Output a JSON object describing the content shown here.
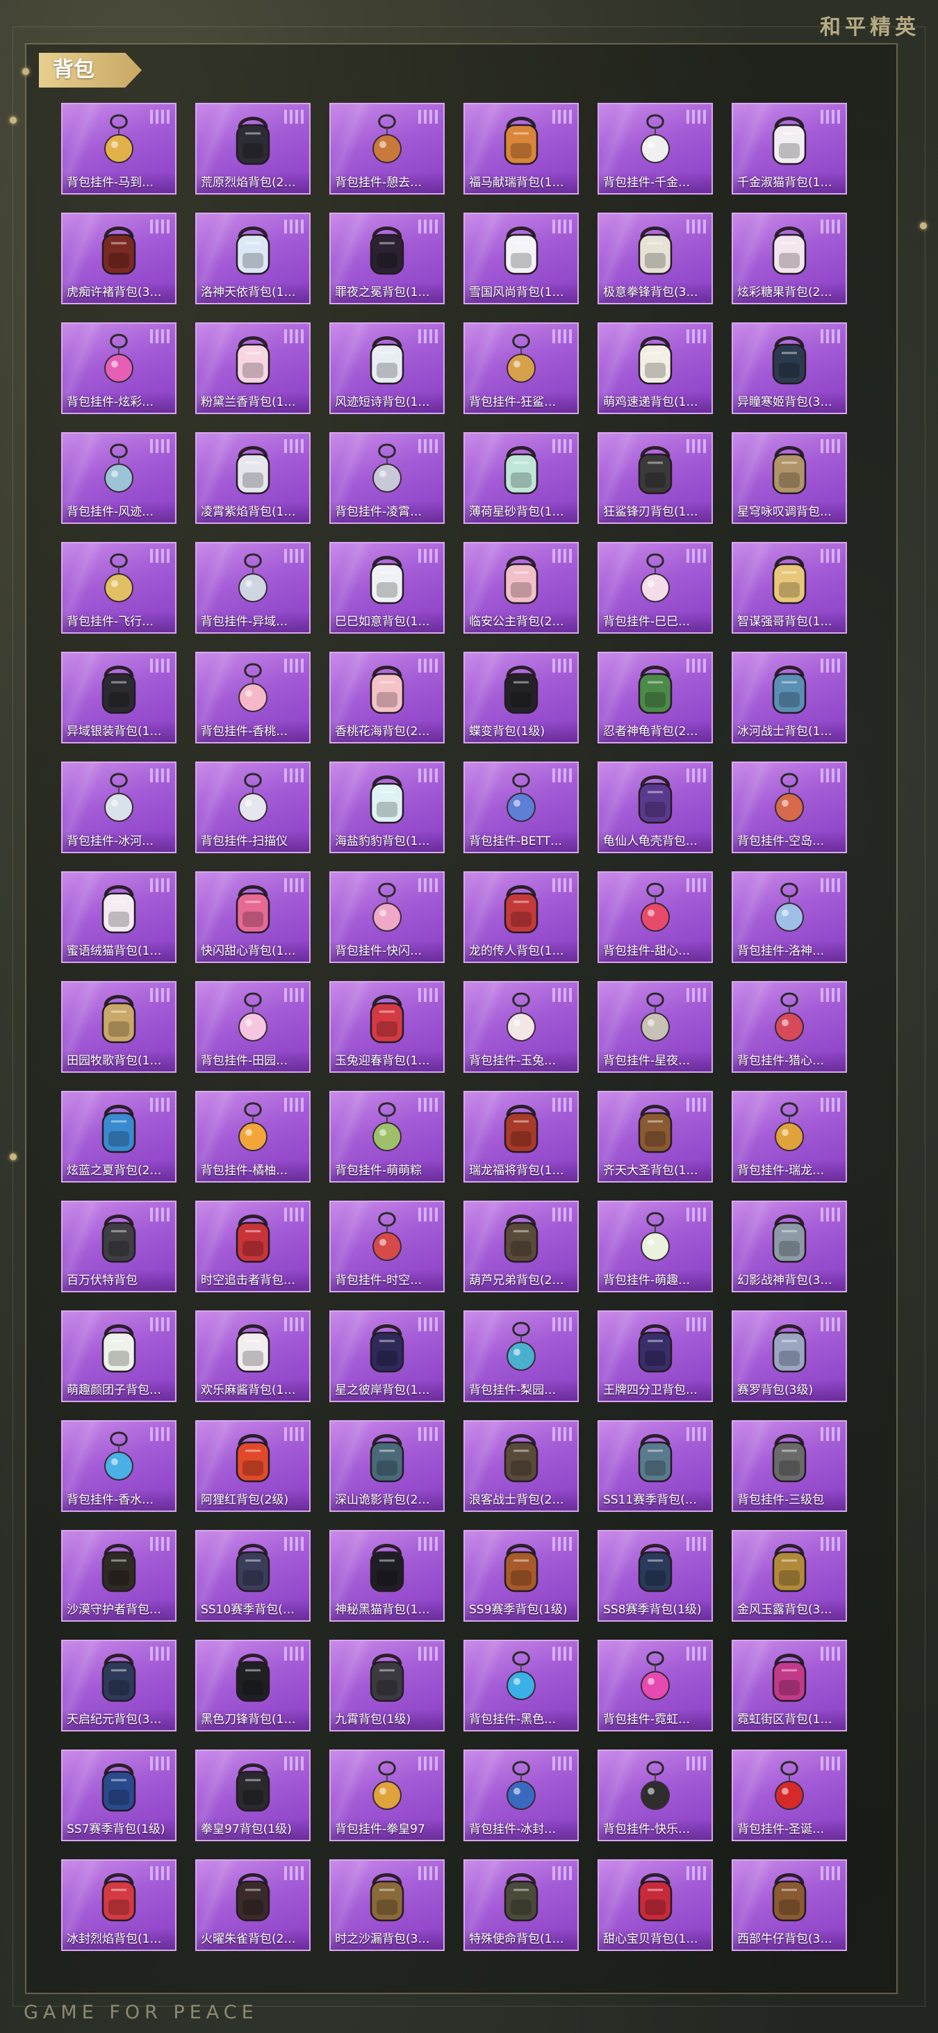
{
  "brand": {
    "logo_text": "和平精英",
    "footer_text": "GAME FOR PEACE"
  },
  "section": {
    "title": "背包"
  },
  "items": [
    {
      "name": "背包挂件-马到…",
      "icon": "horse-charm-icon",
      "color": "#e2b24a"
    },
    {
      "name": "荒原烈焰背包(2…",
      "icon": "backpack-icon",
      "color": "#2c2c34"
    },
    {
      "name": "背包挂件-憩去…",
      "icon": "tag-charm-icon",
      "color": "#c97a3a"
    },
    {
      "name": "福马献瑞背包(1…",
      "icon": "backpack-icon",
      "color": "#d9853a"
    },
    {
      "name": "背包挂件-千金…",
      "icon": "charm-icon",
      "color": "#f0f0f0"
    },
    {
      "name": "千金淑猫背包(1…",
      "icon": "backpack-icon",
      "color": "#f2eef2"
    },
    {
      "name": "虎痴许褚背包(3…",
      "icon": "backpack-icon",
      "color": "#7a2a22"
    },
    {
      "name": "洛神天依背包(1…",
      "icon": "backpack-icon",
      "color": "#dce8f5"
    },
    {
      "name": "罪夜之冕背包(1…",
      "icon": "backpack-icon",
      "color": "#2a2230"
    },
    {
      "name": "雪国风尚背包(1…",
      "icon": "backpack-icon",
      "color": "#f4f4f8"
    },
    {
      "name": "极意拳锋背包(3…",
      "icon": "backpack-icon",
      "color": "#e6e2d6"
    },
    {
      "name": "炫彩糖果背包(2…",
      "icon": "backpack-icon",
      "color": "#f4e6ee"
    },
    {
      "name": "背包挂件-炫彩…",
      "icon": "candy-charm-icon",
      "color": "#e55fb5"
    },
    {
      "name": "粉黛兰香背包(1…",
      "icon": "backpack-icon",
      "color": "#f7d6e2"
    },
    {
      "name": "风迹短诗背包(1…",
      "icon": "backpack-icon",
      "color": "#e8eef2"
    },
    {
      "name": "背包挂件-狂鲨…",
      "icon": "feather-charm-icon",
      "color": "#d6a14a"
    },
    {
      "name": "萌鸡速递背包(1…",
      "icon": "backpack-icon",
      "color": "#f3efe4"
    },
    {
      "name": "异瞳寒姬背包(3…",
      "icon": "backpack-icon",
      "color": "#2c3a4e"
    },
    {
      "name": "背包挂件-风迹…",
      "icon": "card-charm-icon",
      "color": "#9cc4d6"
    },
    {
      "name": "凌霄紫焰背包(1…",
      "icon": "backpack-icon",
      "color": "#e6e6ee"
    },
    {
      "name": "背包挂件-凌霄…",
      "icon": "gem-charm-icon",
      "color": "#c8c8d8"
    },
    {
      "name": "薄荷星砂背包(1…",
      "icon": "backpack-icon",
      "color": "#bfe6d8"
    },
    {
      "name": "狂鲨锋刃背包(1…",
      "icon": "backpack-icon",
      "color": "#3a3a3a"
    },
    {
      "name": "星穹咏叹调背包…",
      "icon": "backpack-icon",
      "color": "#b0946a"
    },
    {
      "name": "背包挂件-飞行…",
      "icon": "plane-charm-icon",
      "color": "#e1bf63"
    },
    {
      "name": "背包挂件-异域…",
      "icon": "gem-charm-icon",
      "color": "#cfd6e2"
    },
    {
      "name": "巳巳如意背包(1…",
      "icon": "backpack-icon",
      "color": "#eef2f4"
    },
    {
      "name": "临安公主背包(2…",
      "icon": "backpack-icon",
      "color": "#f2c0c8"
    },
    {
      "name": "背包挂件-巳巳…",
      "icon": "charm-icon",
      "color": "#f4dce8"
    },
    {
      "name": "智谋强哥背包(1…",
      "icon": "backpack-icon",
      "color": "#e8c77a"
    },
    {
      "name": "异域银装背包(1…",
      "icon": "backpack-icon",
      "color": "#2a2a30"
    },
    {
      "name": "背包挂件-香桃…",
      "icon": "flower-charm-icon",
      "color": "#f6b8c8"
    },
    {
      "name": "香桃花海背包(2…",
      "icon": "backpack-icon",
      "color": "#f5c2c8"
    },
    {
      "name": "蝶变背包(1级)",
      "icon": "backpack-icon",
      "color": "#232327"
    },
    {
      "name": "忍者神龟背包(2…",
      "icon": "backpack-icon",
      "color": "#4c8a4a"
    },
    {
      "name": "冰河战士背包(1…",
      "icon": "backpack-icon",
      "color": "#5b8fb4"
    },
    {
      "name": "背包挂件-冰河…",
      "icon": "robot-charm-icon",
      "color": "#d9e2ea"
    },
    {
      "name": "背包挂件-扫描仪",
      "icon": "scanner-charm-icon",
      "color": "#e6e6ee"
    },
    {
      "name": "海盐豹豹背包(1…",
      "icon": "backpack-icon",
      "color": "#dff2f4"
    },
    {
      "name": "背包挂件-BETT…",
      "icon": "gem-charm-icon",
      "color": "#5e7fd6"
    },
    {
      "name": "龟仙人龟壳背包…",
      "icon": "backpack-icon",
      "color": "#5a3a8e"
    },
    {
      "name": "背包挂件-空岛…",
      "icon": "key-charm-icon",
      "color": "#d66a4a"
    },
    {
      "name": "蜜语绒猫背包(1…",
      "icon": "backpack-icon",
      "color": "#f4ecf2"
    },
    {
      "name": "快闪甜心背包(1…",
      "icon": "backpack-icon",
      "color": "#e66a94"
    },
    {
      "name": "背包挂件-快闪…",
      "icon": "donut-charm-icon",
      "color": "#f0a8c8"
    },
    {
      "name": "龙的传人背包(1…",
      "icon": "backpack-icon",
      "color": "#c43a3a"
    },
    {
      "name": "背包挂件-甜心…",
      "icon": "lollipop-charm-icon",
      "color": "#e84a6a"
    },
    {
      "name": "背包挂件-洛神…",
      "icon": "bow-charm-icon",
      "color": "#9ec0e6"
    },
    {
      "name": "田园牧歌背包(1…",
      "icon": "backpack-icon",
      "color": "#c9a86a"
    },
    {
      "name": "背包挂件-田园…",
      "icon": "tag-charm-icon",
      "color": "#f6c6e0"
    },
    {
      "name": "玉兔迎春背包(1…",
      "icon": "backpack-icon",
      "color": "#d43a42"
    },
    {
      "name": "背包挂件-玉兔…",
      "icon": "rabbit-charm-icon",
      "color": "#f4e6e6"
    },
    {
      "name": "背包挂件-星夜…",
      "icon": "star-charm-icon",
      "color": "#c8c2b6"
    },
    {
      "name": "背包挂件-猎心…",
      "icon": "key-charm-icon",
      "color": "#d64a5a"
    },
    {
      "name": "炫蓝之夏背包(2…",
      "icon": "backpack-icon",
      "color": "#3a8ad0"
    },
    {
      "name": "背包挂件-橘柚…",
      "icon": "heart-charm-icon",
      "color": "#f2a63a"
    },
    {
      "name": "背包挂件-萌萌粽",
      "icon": "zongzi-charm-icon",
      "color": "#9ec06a"
    },
    {
      "name": "瑞龙福将背包(1…",
      "icon": "backpack-icon",
      "color": "#a83a2a"
    },
    {
      "name": "齐天大圣背包(1…",
      "icon": "backpack-icon",
      "color": "#8a5a32"
    },
    {
      "name": "背包挂件-瑞龙…",
      "icon": "orb-charm-icon",
      "color": "#e0a23a"
    },
    {
      "name": "百万伏特背包",
      "icon": "backpack-icon",
      "color": "#3e3e44"
    },
    {
      "name": "时空追击者背包…",
      "icon": "backpack-icon",
      "color": "#c8343a"
    },
    {
      "name": "背包挂件-时空…",
      "icon": "wing-charm-icon",
      "color": "#d64a4a"
    },
    {
      "name": "葫芦兄弟背包(2…",
      "icon": "backpack-icon",
      "color": "#5a4a3a"
    },
    {
      "name": "背包挂件-萌趣…",
      "icon": "slime-charm-icon",
      "color": "#e8f2dc"
    },
    {
      "name": "幻影战神背包(3…",
      "icon": "backpack-icon",
      "color": "#8e9aa6"
    },
    {
      "name": "萌趣颜团子背包…",
      "icon": "backpack-icon",
      "color": "#eef2ea"
    },
    {
      "name": "欢乐麻酱背包(1…",
      "icon": "backpack-icon",
      "color": "#f2eef0"
    },
    {
      "name": "星之彼岸背包(1…",
      "icon": "backpack-icon",
      "color": "#2e2a5a"
    },
    {
      "name": "背包挂件-梨园…",
      "icon": "lantern-charm-icon",
      "color": "#4ab0d0"
    },
    {
      "name": "王牌四分卫背包…",
      "icon": "backpack-icon",
      "color": "#3a2e6a"
    },
    {
      "name": "赛罗背包(3级)",
      "icon": "backpack-icon",
      "color": "#9aa6c2"
    },
    {
      "name": "背包挂件-香水…",
      "icon": "cocktail-charm-icon",
      "color": "#4ab0e6"
    },
    {
      "name": "阿狸红背包(2级)",
      "icon": "backpack-icon",
      "color": "#e04a2a"
    },
    {
      "name": "深山诡影背包(2…",
      "icon": "backpack-icon",
      "color": "#4a6a7a"
    },
    {
      "name": "浪客战士背包(2…",
      "icon": "backpack-icon",
      "color": "#5a4a3a"
    },
    {
      "name": "SS11赛季背包(…",
      "icon": "backpack-icon",
      "color": "#5a7a8e"
    },
    {
      "name": "背包挂件-三级包",
      "icon": "backpack-icon",
      "color": "#6a6a6a"
    },
    {
      "name": "沙漠守护者背包…",
      "icon": "backpack-icon",
      "color": "#2e2a24"
    },
    {
      "name": "SS10赛季背包(…",
      "icon": "backpack-icon",
      "color": "#3a3e5a"
    },
    {
      "name": "神秘黑猫背包(1…",
      "icon": "backpack-icon",
      "color": "#1e1e24"
    },
    {
      "name": "SS9赛季背包(1级)",
      "icon": "backpack-icon",
      "color": "#a85a2a"
    },
    {
      "name": "SS8赛季背包(1级)",
      "icon": "backpack-icon",
      "color": "#2a3a5a"
    },
    {
      "name": "金风玉露背包(3…",
      "icon": "backpack-icon",
      "color": "#b08a3a"
    },
    {
      "name": "天启纪元背包(3…",
      "icon": "backpack-icon",
      "color": "#2e3a5a"
    },
    {
      "name": "黑色刀锋背包(1…",
      "icon": "backpack-icon",
      "color": "#1e2024"
    },
    {
      "name": "九霄背包(1级)",
      "icon": "backpack-icon",
      "color": "#3a3a40"
    },
    {
      "name": "背包挂件-黑色…",
      "icon": "badge-charm-icon",
      "color": "#3ab0e6"
    },
    {
      "name": "背包挂件-霓虹…",
      "icon": "hat-charm-icon",
      "color": "#e64ab0"
    },
    {
      "name": "霓虹街区背包(1…",
      "icon": "backpack-icon",
      "color": "#c23a8a"
    },
    {
      "name": "SS7赛季背包(1级)",
      "icon": "backpack-icon",
      "color": "#2a4a8e"
    },
    {
      "name": "拳皇97背包(1级)",
      "icon": "backpack-icon",
      "color": "#2a2a2e"
    },
    {
      "name": "背包挂件-拳皇97",
      "icon": "figure-charm-icon",
      "color": "#e0a23a"
    },
    {
      "name": "背包挂件-冰封…",
      "icon": "orb-charm-icon",
      "color": "#3a6ac0"
    },
    {
      "name": "背包挂件-快乐…",
      "icon": "ball-charm-icon",
      "color": "#2e2e2e"
    },
    {
      "name": "背包挂件-圣诞…",
      "icon": "santa-hat-charm-icon",
      "color": "#d62a2a"
    },
    {
      "name": "冰封烈焰背包(1…",
      "icon": "backpack-icon",
      "color": "#d43a42"
    },
    {
      "name": "火曜朱雀背包(2…",
      "icon": "backpack-icon",
      "color": "#3a2a2a"
    },
    {
      "name": "时之沙漏背包(3…",
      "icon": "backpack-icon",
      "color": "#8a6a3a"
    },
    {
      "name": "特殊使命背包(1…",
      "icon": "backpack-icon",
      "color": "#4a4a3a"
    },
    {
      "name": "甜心宝贝背包(1…",
      "icon": "backpack-icon",
      "color": "#c82a3a"
    },
    {
      "name": "西部牛仔背包(3…",
      "icon": "backpack-icon",
      "color": "#8a5a32"
    }
  ]
}
